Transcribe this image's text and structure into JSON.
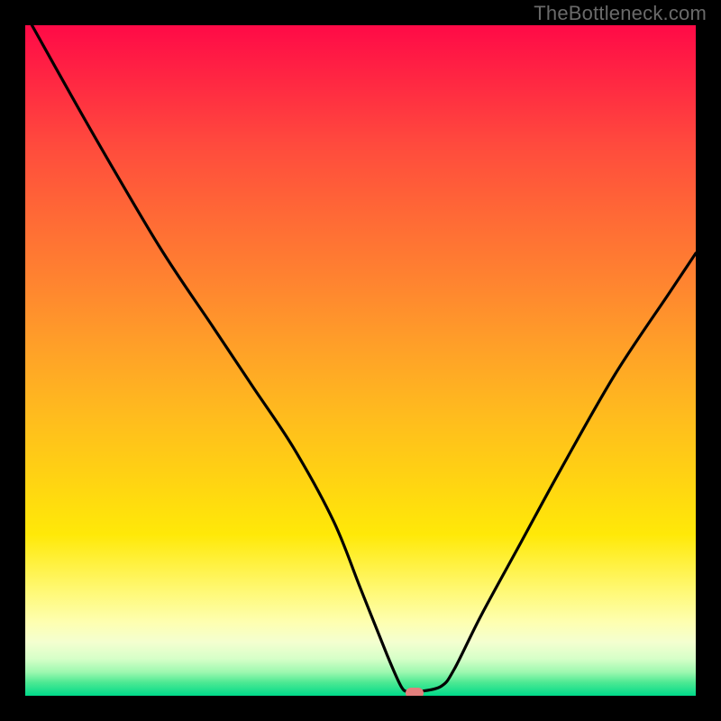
{
  "watermark": "TheBottleneck.com",
  "chart_data": {
    "type": "line",
    "title": "",
    "xlabel": "",
    "ylabel": "",
    "xlim": [
      0,
      100
    ],
    "ylim": [
      0,
      100
    ],
    "grid": false,
    "legend": false,
    "series": [
      {
        "name": "bottleneck-curve",
        "x": [
          1,
          10,
          20,
          28,
          34,
          40,
          46,
          50,
          54,
          56,
          57,
          58.5,
          62,
          64,
          68,
          74,
          80,
          88,
          96,
          100
        ],
        "values": [
          100,
          84,
          67,
          55,
          46,
          37,
          26,
          16,
          6,
          1.5,
          0.6,
          0.6,
          1.4,
          4,
          12,
          23,
          34,
          48,
          60,
          66
        ]
      }
    ],
    "marker": {
      "x": 58,
      "y": 0.4,
      "color": "#e37f7d"
    },
    "background_gradient": {
      "stops": [
        {
          "pct": 0,
          "color": "#ff0a47"
        },
        {
          "pct": 50,
          "color": "#ffa028"
        },
        {
          "pct": 80,
          "color": "#fff200"
        },
        {
          "pct": 100,
          "color": "#00da8a"
        }
      ]
    },
    "frame_color": "#000000"
  }
}
